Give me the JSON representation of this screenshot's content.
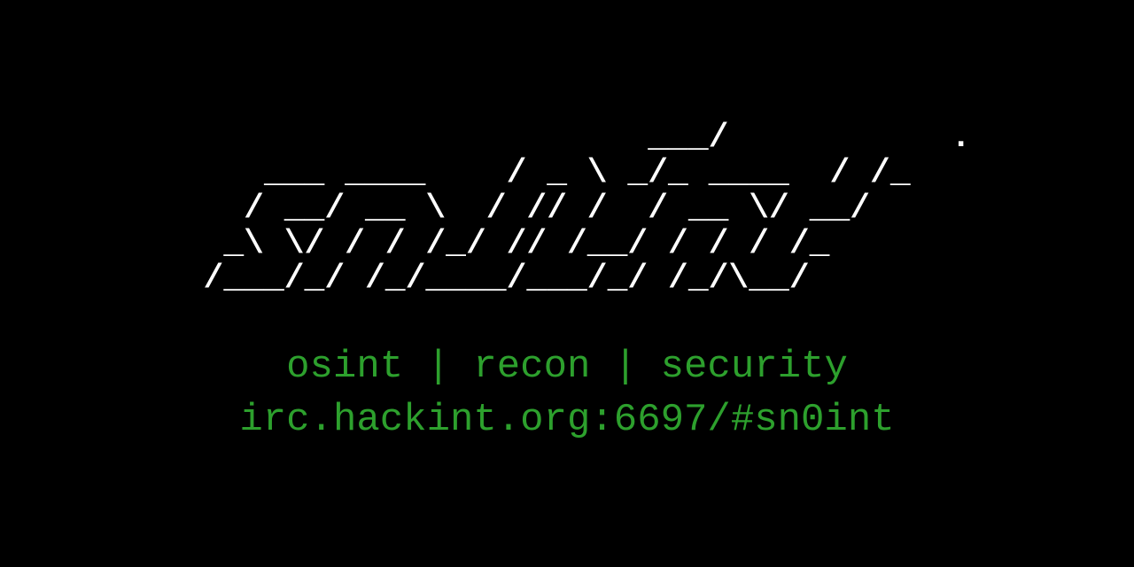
{
  "ascii_logo": "                        ___/           .\n     ___ ____    / _ \\ _/_ ____  / /_\n    / __/ __ \\  / // /  / __ \\/ __/\n   _\\ \\/ / / /_/ // /__/ / / / /_\n  /___/_/ /_/____/___/_/ /_/\\__/",
  "tags": {
    "tag1": "osint",
    "sep1": " | ",
    "tag2": "recon",
    "sep2": " | ",
    "tag3": "security"
  },
  "irc": "irc.hackint.org:6697/#sn0int"
}
